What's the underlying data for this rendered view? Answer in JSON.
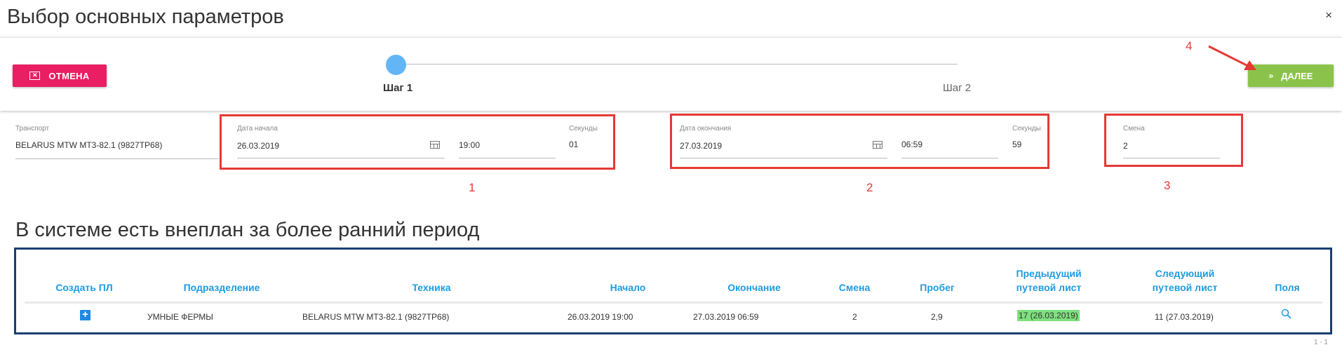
{
  "dialog": {
    "title": "Выбор основных параметров",
    "close": "×"
  },
  "toolbar": {
    "cancel_label": "ОТМЕНА",
    "next_label": "ДАЛЕЕ",
    "next_icon": "»"
  },
  "stepper": {
    "step1": "Шаг 1",
    "step2": "Шаг 2"
  },
  "form": {
    "transport": {
      "label": "Транспорт",
      "value": "BELARUS MTW MT3-82.1 (9827ТР68)"
    },
    "start": {
      "date_label": "Дата начала",
      "date": "26.03.2019",
      "time": "19:00",
      "seconds_label": "Секунды",
      "seconds": "01"
    },
    "end": {
      "date_label": "Дата окончания",
      "date": "27.03.2019",
      "time": "06:59",
      "seconds_label": "Секунды",
      "seconds": "59"
    },
    "shift": {
      "label": "Смена",
      "value": "2"
    }
  },
  "annotations": {
    "n1": "1",
    "n2": "2",
    "n3": "3",
    "n4": "4",
    "color": "#e53935"
  },
  "section": {
    "title": "В системе есть внеплан за более ранний период"
  },
  "table": {
    "headers": {
      "create": "Создать ПЛ",
      "division": "Подразделение",
      "vehicle": "Техника",
      "start": "Начало",
      "end": "Окончание",
      "shift": "Смена",
      "mileage": "Пробег",
      "prev1": "Предыдущий",
      "prev2": "путевой лист",
      "next1": "Следующий",
      "next2": "путевой лист",
      "fields": "Поля"
    },
    "row": {
      "create": "+",
      "division": "УМНЫЕ ФЕРМЫ",
      "vehicle": "BELARUS MTW MT3-82.1 (9827ТР68)",
      "start": "26.03.2019 19:00",
      "end": "27.03.2019 06:59",
      "shift": "2",
      "mileage": "2,9",
      "prev": "17 (26.03.2019)",
      "next": "11 (27.03.2019)"
    },
    "pager": "1 - 1"
  },
  "colors": {
    "accent": "#1e9be0",
    "cancel": "#e91e63",
    "next": "#8bc34a",
    "highlight": "#7ee07e",
    "table_border": "#1a3f6f"
  },
  "icons": {
    "cancel": "close-box-icon",
    "next": "double-chevron-right-icon",
    "calendar": "calendar-icon",
    "search": "search-icon",
    "add": "plus-box-icon"
  }
}
